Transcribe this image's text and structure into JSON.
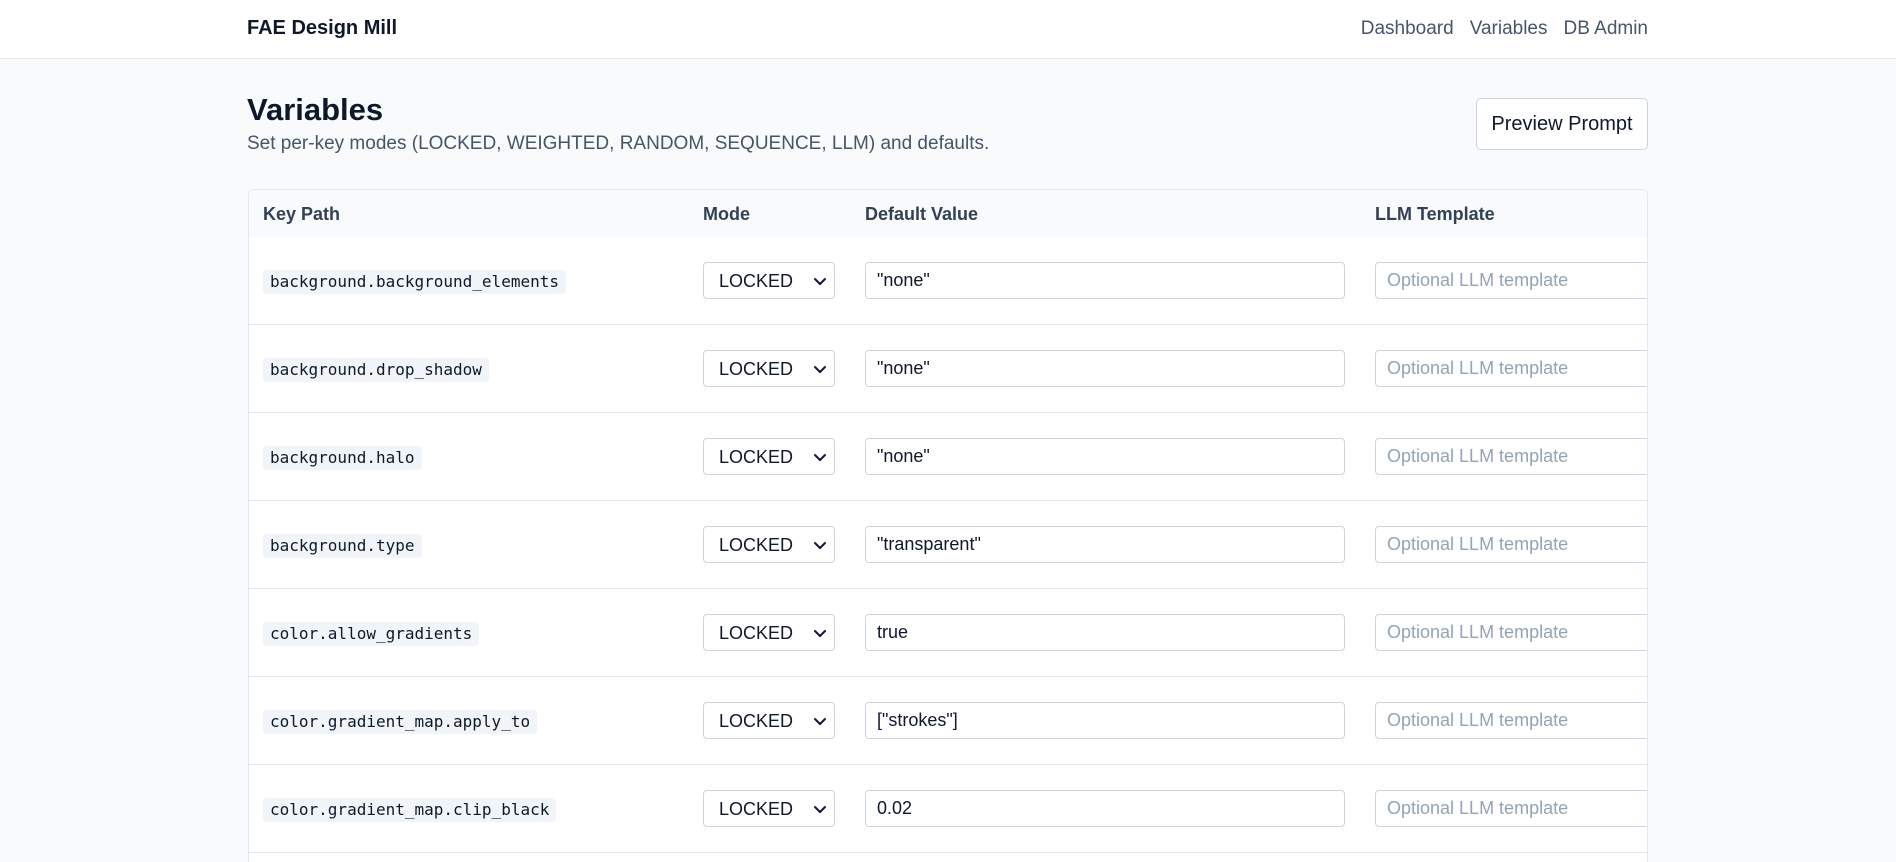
{
  "app": {
    "brand": "FAE Design Mill",
    "nav": [
      "Dashboard",
      "Variables",
      "DB Admin"
    ]
  },
  "page": {
    "title": "Variables",
    "subtitle": "Set per-key modes (LOCKED, WEIGHTED, RANDOM, SEQUENCE, LLM) and defaults.",
    "preview_label": "Preview Prompt"
  },
  "table": {
    "headers": [
      "Key Path",
      "Mode",
      "Default Value",
      "LLM Template"
    ],
    "template_placeholder": "Optional LLM template",
    "rows": [
      {
        "key": "background.background_elements",
        "mode": "LOCKED",
        "value": "\"none\""
      },
      {
        "key": "background.drop_shadow",
        "mode": "LOCKED",
        "value": "\"none\""
      },
      {
        "key": "background.halo",
        "mode": "LOCKED",
        "value": "\"none\""
      },
      {
        "key": "background.type",
        "mode": "LOCKED",
        "value": "\"transparent\""
      },
      {
        "key": "color.allow_gradients",
        "mode": "LOCKED",
        "value": "true"
      },
      {
        "key": "color.gradient_map.apply_to",
        "mode": "LOCKED",
        "value": "[\"strokes\"]"
      },
      {
        "key": "color.gradient_map.clip_black",
        "mode": "LOCKED",
        "value": "0.02"
      }
    ]
  },
  "colors": {
    "page_bg": "#f8fafc",
    "border": "#e2e8f0",
    "muted_text": "#475569",
    "placeholder": "#94a3b8"
  }
}
